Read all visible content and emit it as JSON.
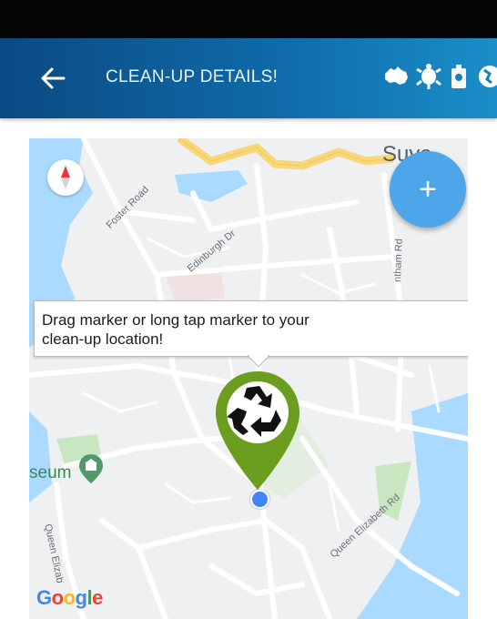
{
  "app_bar": {
    "title": "CLEAN-UP DETAILS!",
    "back_icon": "arrow-left-icon",
    "action_icons": [
      "map-australia-icon",
      "turtle-icon",
      "trash-bin-icon",
      "globe-icon"
    ]
  },
  "map": {
    "city": "Suva",
    "streets": [
      "Foster Road",
      "Edinburgh Dr",
      "ntham Rd",
      "Queen Elizabeth Rd",
      "Queen Elizab"
    ],
    "poi": "seum",
    "attribution": "Google",
    "compass_icon": "compass-icon",
    "tooltip": {
      "line1": "Drag marker or long tap marker to your",
      "line2": "clean-up location!"
    },
    "marker_icon": "recycle-marker-icon"
  },
  "fab": {
    "label": "+"
  },
  "colors": {
    "app_bar": "#0f6aa8",
    "fab": "#4ea6ea",
    "marker": "#6b9e1f",
    "water": "#aadaff",
    "road_major": "#f8d77a"
  }
}
